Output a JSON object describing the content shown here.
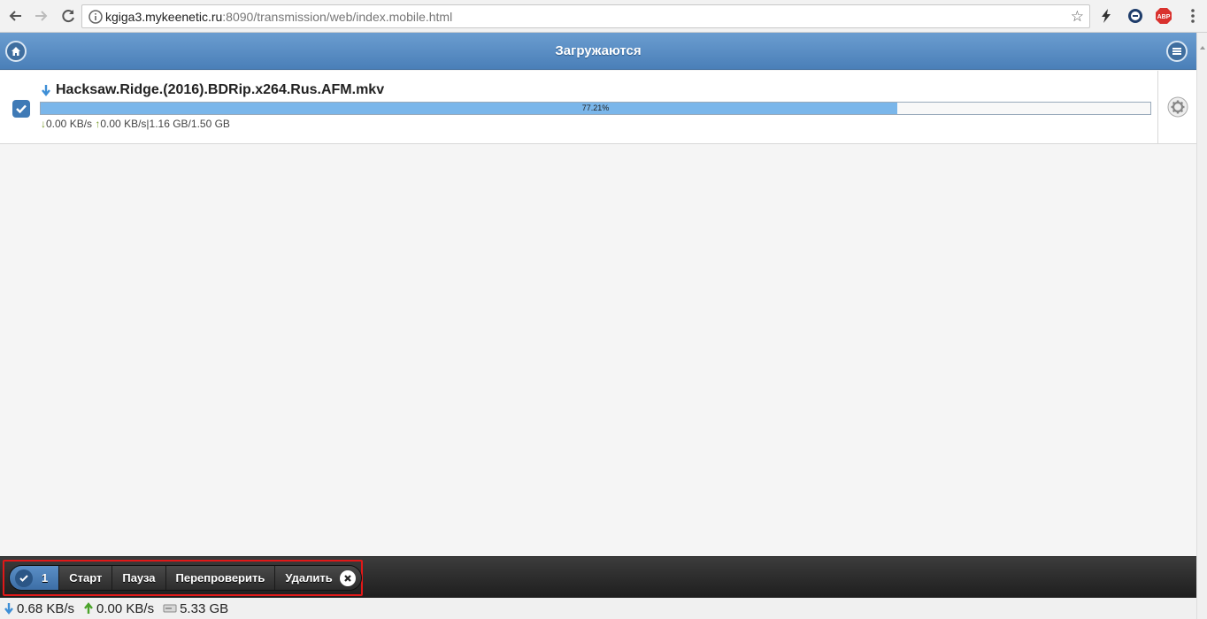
{
  "browser": {
    "url_host": "kgiga3.mykeenetic.ru",
    "url_path": ":8090/transmission/web/index.mobile.html",
    "abp_label": "ABP"
  },
  "header": {
    "title": "Загружаются"
  },
  "torrent": {
    "name": "Hacksaw.Ridge.(2016).BDRip.x264.Rus.AFM.mkv",
    "progress_percent": 77.21,
    "progress_label": "77.21%",
    "down_speed": "0.00 KB/s",
    "up_speed": "0.00 KB/s",
    "size": "1.16 GB/1.50 GB",
    "selected": true
  },
  "toolbar": {
    "selected_count": "1",
    "start_label": "Старт",
    "pause_label": "Пауза",
    "verify_label": "Перепроверить",
    "remove_label": "Удалить"
  },
  "status": {
    "down_speed": "0.68 KB/s",
    "up_speed": "0.00 KB/s",
    "free_space": "5.33 GB"
  },
  "colors": {
    "header": "#4a7fb8",
    "progress": "#7ab6ea",
    "highlight": "#e01818"
  }
}
